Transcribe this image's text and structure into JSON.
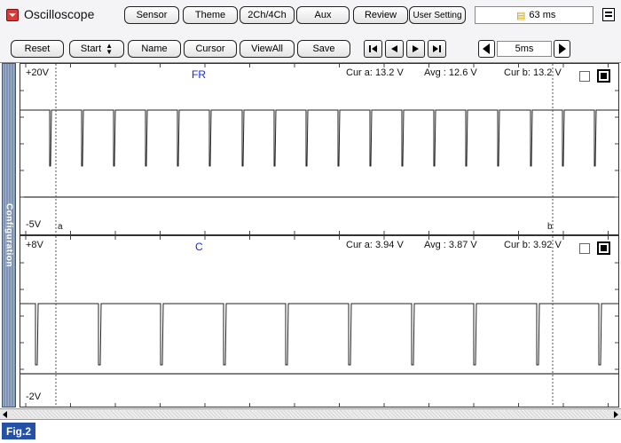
{
  "toolbar": {
    "app_title": "Oscilloscope",
    "app_icon": "red-square-dropdown-icon",
    "top_buttons": [
      "Sensor",
      "Theme",
      "2Ch/4Ch",
      "Aux",
      "Review",
      "User Setting"
    ],
    "sample_time": "63 ms",
    "bottom_buttons": {
      "reset": "Reset",
      "start": "Start",
      "name": "Name",
      "cursor": "Cursor",
      "viewall": "ViewAll",
      "save": "Save"
    },
    "timebase": "5ms"
  },
  "sidebar": {
    "label": "Configuration"
  },
  "channels": [
    {
      "name": "FR",
      "top_label": "+20V",
      "bottom_label": "-5V",
      "cur_a": "Cur a: 13.2 V",
      "avg": "Avg  : 12.6 V",
      "cur_b": "Cur b: 13.2 V",
      "cursor_a_label": "a",
      "cursor_b_label": "b"
    },
    {
      "name": "C",
      "top_label": "+8V",
      "bottom_label": "-2V",
      "cur_a": "Cur a: 3.94 V",
      "avg": "Avg  : 3.87 V",
      "cur_b": "Cur b: 3.92 V"
    }
  ],
  "figure_label": "Fig.2",
  "colors": {
    "trace": "#222222",
    "channel_name": "#1a2ad8",
    "sidebar": "#7f93b5",
    "figure_label_bg": "#2450a6"
  }
}
